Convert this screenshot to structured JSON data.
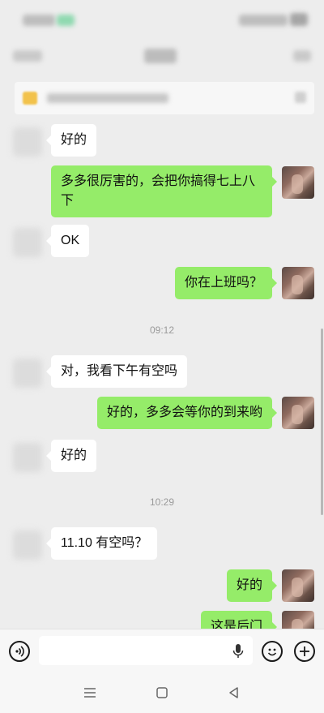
{
  "chat": {
    "messages": [
      {
        "text": "好的"
      },
      {
        "text": "多多很厉害的，会把你搞得七上八下"
      },
      {
        "text": "OK"
      },
      {
        "text": "你在上班吗？"
      },
      {
        "text": "对，我看下午有空吗"
      },
      {
        "text": "好的，多多会等你的到来哟"
      },
      {
        "text": "好的"
      },
      {
        "text": "11.10 有空吗？"
      },
      {
        "text": "好的"
      },
      {
        "text": "这是后门"
      }
    ],
    "timestamps": [
      "09:12",
      "10:29"
    ]
  },
  "input_bar": {
    "voice_icon": "voice-icon",
    "mic_icon": "mic-icon",
    "emoji_icon": "emoji-icon",
    "add_icon": "plus-icon"
  },
  "colors": {
    "background": "#ededed",
    "outgoing_bubble": "#95ec69",
    "incoming_bubble": "#ffffff"
  }
}
